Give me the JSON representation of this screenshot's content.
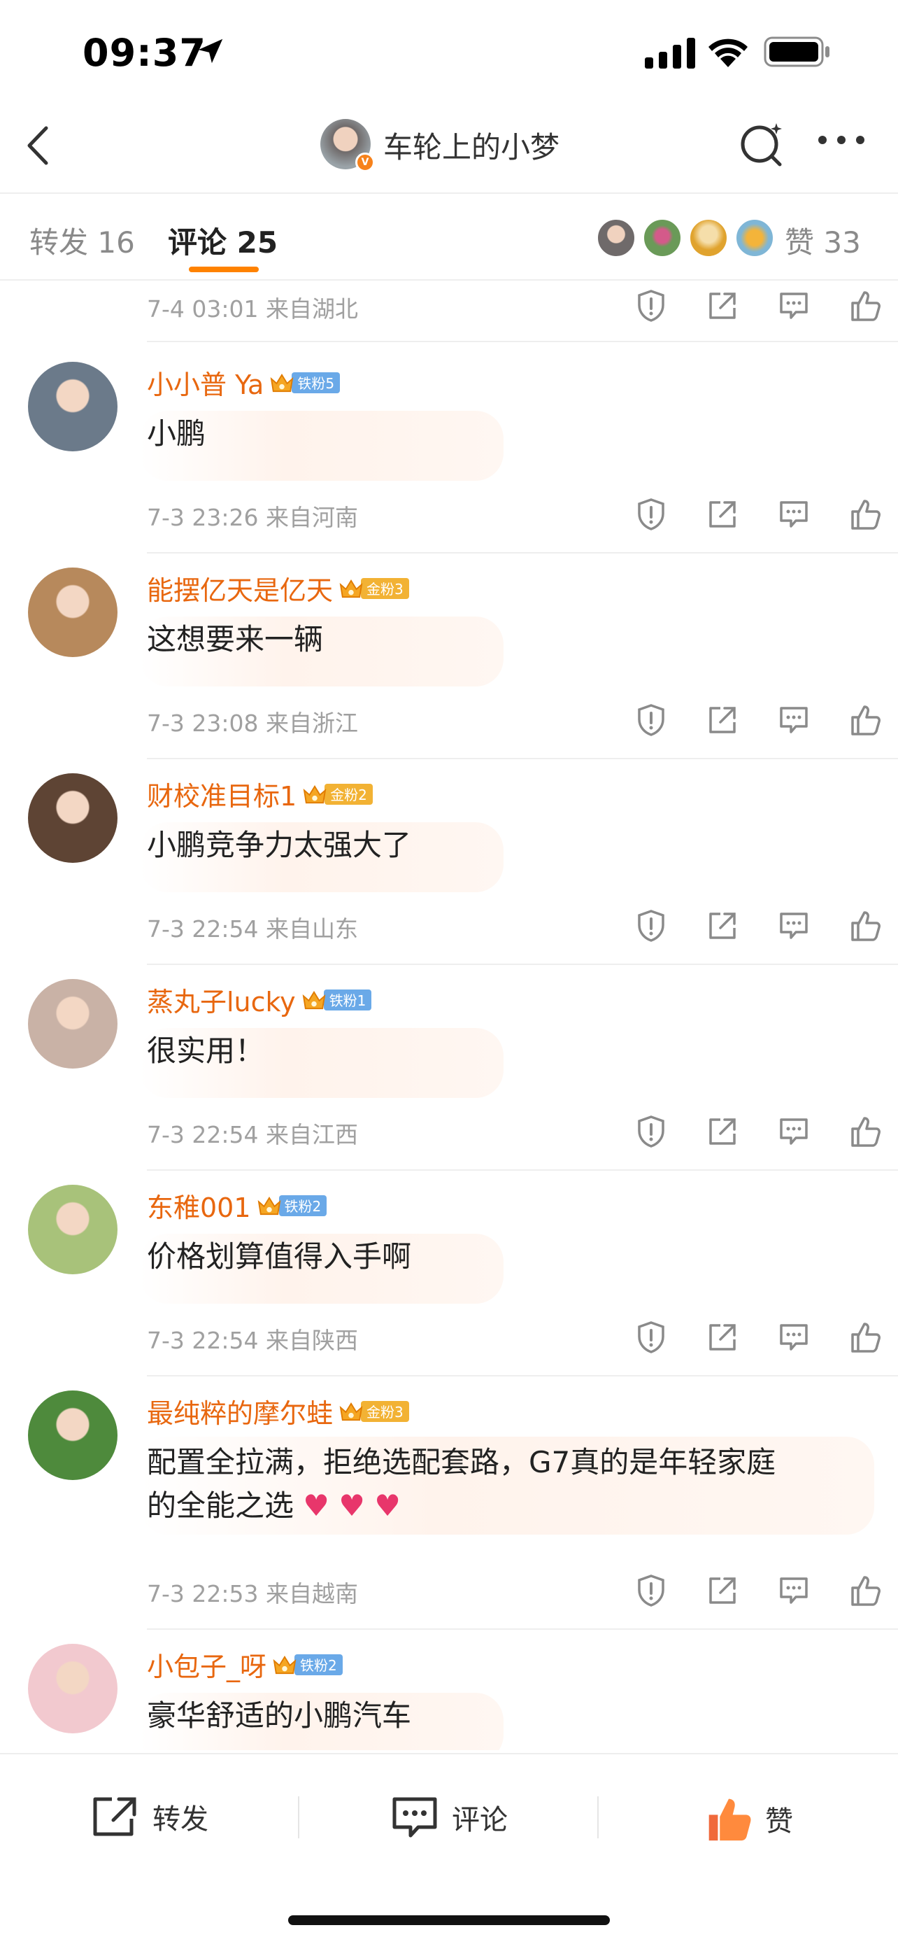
{
  "status_bar": {
    "time": "09:37"
  },
  "header": {
    "title": "车轮上的小梦",
    "verified_badge": "V"
  },
  "tabs": {
    "repost": {
      "label": "转发",
      "count": "16"
    },
    "comment": {
      "label": "评论",
      "count": "25"
    },
    "likes": {
      "label": "赞",
      "count": "33"
    }
  },
  "top_meta": {
    "time": "7-4 03:01",
    "location": "来自湖北"
  },
  "comments": [
    {
      "name": "小小普 Ya",
      "fan_level": "铁粉5",
      "fan_type": "iron",
      "text": "小鹏",
      "time": "7-3 23:26",
      "location": "来自河南",
      "avatar_color": "#6b7a8a",
      "emoji": [
        "capybara-sticker"
      ]
    },
    {
      "name": "能摆亿天是亿天",
      "fan_level": "金粉3",
      "fan_type": "gold",
      "text": "这想要来一辆",
      "time": "7-3 23:08",
      "location": "来自浙江",
      "avatar_color": "#b7895c",
      "emoji": [
        "gold-crown-sticker"
      ]
    },
    {
      "name": "财校准目标1",
      "fan_level": "金粉2",
      "fan_type": "gold",
      "text": "小鹏竞争力太强大了",
      "time": "7-3 22:54",
      "location": "来自山东",
      "avatar_color": "#5e4434",
      "emoji": [
        "gold-crown-sticker"
      ]
    },
    {
      "name": "蒸丸子lucky",
      "fan_level": "铁粉1",
      "fan_type": "iron",
      "text": "很实用！",
      "time": "7-3 22:54",
      "location": "来自江西",
      "avatar_color": "#c9b2a6",
      "emoji": [
        "thumbs-up-emoji",
        "cat-sticker"
      ]
    },
    {
      "name": "东稚001",
      "fan_level": "铁粉2",
      "fan_type": "iron",
      "text": "价格划算值得入手啊",
      "time": "7-3 22:54",
      "location": "来自陕西",
      "avatar_color": "#a8c27a",
      "emoji": [
        "cheer-emoji",
        "cheer-emoji",
        "pig-sticker"
      ]
    },
    {
      "name": "最纯粹的摩尔蛙",
      "fan_level": "金粉3",
      "fan_type": "gold",
      "text_line1": "配置全拉满，拒绝选配套路，G7真的是年轻家庭",
      "text_line2": "的全能之选",
      "time": "7-3 22:53",
      "location": "来自越南",
      "avatar_color": "#4e8a3c",
      "emoji": [
        "heart-emoji",
        "heart-emoji",
        "heart-emoji",
        "gold-crown-sticker"
      ]
    },
    {
      "name": "小包子_呀",
      "fan_level": "铁粉2",
      "fan_type": "iron",
      "text": "豪华舒适的小鹏汽车",
      "avatar_color": "#f2c9cf"
    }
  ],
  "bottom_bar": {
    "repost": "转发",
    "comment": "评论",
    "like": "赞"
  },
  "colors": {
    "accent": "#ff8200",
    "name": "#e8670f",
    "meta": "#a0a0a0"
  }
}
